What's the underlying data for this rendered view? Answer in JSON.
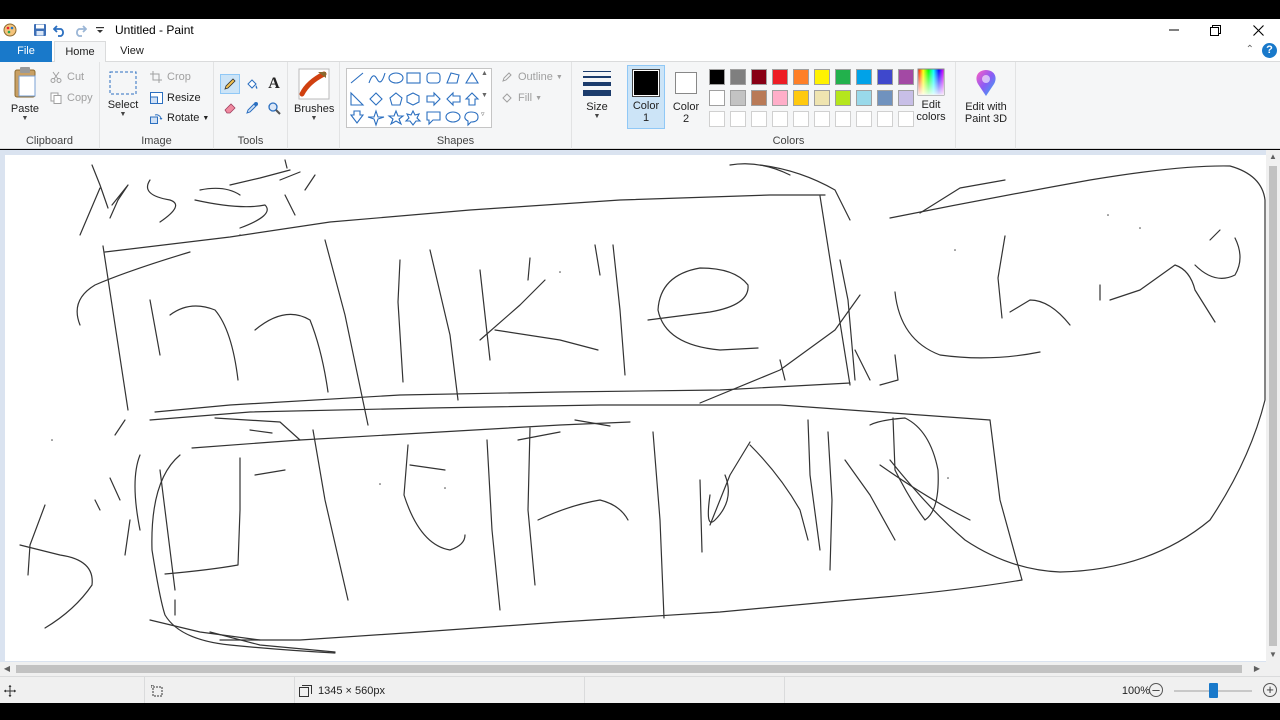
{
  "window": {
    "title": "Untitled - Paint"
  },
  "tabs": {
    "file": "File",
    "home": "Home",
    "view": "View"
  },
  "clipboard": {
    "label": "Clipboard",
    "paste": "Paste",
    "cut": "Cut",
    "copy": "Copy"
  },
  "image": {
    "label": "Image",
    "select": "Select",
    "crop": "Crop",
    "resize": "Resize",
    "rotate": "Rotate"
  },
  "tools": {
    "label": "Tools"
  },
  "brushes": {
    "label": "Brushes"
  },
  "shapes": {
    "label": "Shapes",
    "outline": "Outline",
    "fill": "Fill"
  },
  "size": {
    "label": "Size"
  },
  "colors": {
    "label": "Colors",
    "color1_label": "Color",
    "color1_num": "1",
    "color2_label": "Color",
    "color2_num": "2",
    "color1_value": "#000000",
    "color2_value": "#ffffff",
    "edit_colors_line1": "Edit",
    "edit_colors_line2": "colors",
    "palette_row1": [
      "#000000",
      "#7f7f7f",
      "#880015",
      "#ed1c24",
      "#ff7f27",
      "#fff200",
      "#22b14c",
      "#00a2e8",
      "#3f48cc",
      "#a349a4"
    ],
    "palette_row2": [
      "#ffffff",
      "#c3c3c3",
      "#b97a57",
      "#ffaec9",
      "#ffc90e",
      "#efe4b0",
      "#b5e61d",
      "#99d9ea",
      "#7092be",
      "#c8bfe7"
    ]
  },
  "paint3d": {
    "line1": "Edit with",
    "line2": "Paint 3D"
  },
  "status": {
    "dimensions": "1345 × 560px",
    "zoom": "100%",
    "zoom_level": 0.5
  }
}
